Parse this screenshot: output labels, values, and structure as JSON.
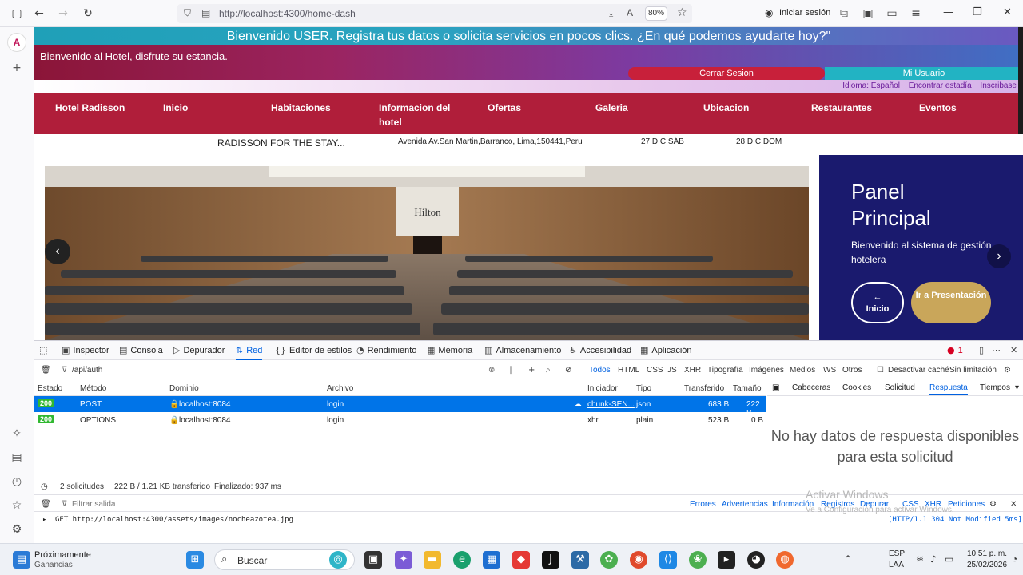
{
  "browser": {
    "url": "http://localhost:4300/home-dash",
    "zoom": "80%",
    "signin_label": "Iniciar sesión"
  },
  "site": {
    "welcome_user": "Bienvenido USER. Registra tus datos o solicita servicios en pocos clics. ¿En qué podemos ayudarte hoy?\"",
    "welcome_hotel": "Bienvenido al Hotel, disfrute su estancia.",
    "logout_label": "Cerrar Sesion",
    "user_label": "Mi Usuario",
    "lang_links": [
      "Idioma: Español",
      "Encontrar estadía",
      "Inscribase"
    ],
    "nav": [
      "Hotel Radisson",
      "Inicio",
      "Habitaciones",
      "Informacion del hotel",
      "Ofertas",
      "Galeria",
      "Ubicacion",
      "Restaurantes",
      "Eventos"
    ],
    "booking": {
      "name": "RADISSON FOR THE STAY...",
      "address": "Avenida Av.San Martin,Barranco, Lima,150441,Peru",
      "checkin": "27 DIC SÁB",
      "checkout": "28 DIC DOM",
      "separator": "|"
    },
    "hero_sign": "Hilton",
    "panel": {
      "title": "Panel Principal",
      "subtitle": "Bienvenido al sistema de gestión hotelera",
      "btn_home_arrow": "←",
      "btn_home": "Inicio",
      "btn_present": "Ir a Presentación"
    },
    "arrow_prev": "‹",
    "arrow_next": "›"
  },
  "devtools": {
    "tabs": [
      "Inspector",
      "Consola",
      "Depurador",
      "Red",
      "Editor de estilos",
      "Rendimiento",
      "Memoria",
      "Almacenamiento",
      "Accesibilidad",
      "Aplicación"
    ],
    "error_count": "1",
    "filter_value": "/api/auth",
    "type_filters": [
      "Todos",
      "HTML",
      "CSS",
      "JS",
      "XHR",
      "Tipografía",
      "Imágenes",
      "Medios",
      "WS",
      "Otros"
    ],
    "disable_cache": "Desactivar caché",
    "throttle": "Sin limitación",
    "columns": [
      "Estado",
      "Método",
      "Dominio",
      "Archivo",
      "Iniciador",
      "Tipo",
      "Transferido",
      "Tamaño"
    ],
    "rows": [
      {
        "status": "200",
        "method": "POST",
        "domain": "localhost:8084",
        "file": "login",
        "initiator": "chunk-SEN...",
        "type": "json",
        "transferred": "683 B",
        "size": "222 B"
      },
      {
        "status": "200",
        "method": "OPTIONS",
        "domain": "localhost:8084",
        "file": "login",
        "initiator": "xhr",
        "type": "plain",
        "transferred": "523 B",
        "size": "0 B"
      }
    ],
    "summary": {
      "requests": "2 solicitudes",
      "transferred": "222 B / 1.21 KB transferido",
      "finished": "Finalizado: 937 ms"
    },
    "side_tabs": [
      "Cabeceras",
      "Cookies",
      "Solicitud",
      "Respuesta",
      "Tiempos"
    ],
    "no_data": "No hay datos de respuesta disponibles para esta solicitud",
    "console_filter_placeholder": "Filtrar salida",
    "console_levels": [
      "Errores",
      "Advertencias",
      "Información",
      "Registros",
      "Depurar",
      "CSS",
      "XHR",
      "Peticiones"
    ],
    "console_line": "GET http://localhost:4300/assets/images/nocheazotea.jpg",
    "console_status": "[HTTP/1.1 304 Not Modified 5ms]",
    "watermark": "Activar Windows",
    "watermark_sub": "Ve a Configuración para activar Windows."
  },
  "taskbar": {
    "widget_title": "Próximamente",
    "widget_sub": "Ganancias",
    "search_placeholder": "Buscar",
    "lang": "ESP",
    "lang_sub": "LAA",
    "time": "10:51 p. m.",
    "date": "25/02/2026"
  }
}
